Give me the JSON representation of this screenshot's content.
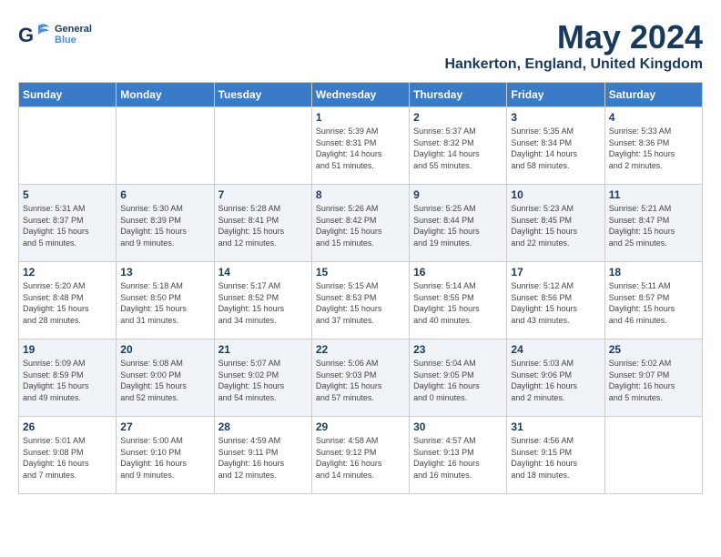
{
  "header": {
    "logo_general": "General",
    "logo_blue": "Blue",
    "month_title": "May 2024",
    "location": "Hankerton, England, United Kingdom"
  },
  "days_of_week": [
    "Sunday",
    "Monday",
    "Tuesday",
    "Wednesday",
    "Thursday",
    "Friday",
    "Saturday"
  ],
  "weeks": [
    [
      {
        "day": "",
        "content": ""
      },
      {
        "day": "",
        "content": ""
      },
      {
        "day": "",
        "content": ""
      },
      {
        "day": "1",
        "content": "Sunrise: 5:39 AM\nSunset: 8:31 PM\nDaylight: 14 hours\nand 51 minutes."
      },
      {
        "day": "2",
        "content": "Sunrise: 5:37 AM\nSunset: 8:32 PM\nDaylight: 14 hours\nand 55 minutes."
      },
      {
        "day": "3",
        "content": "Sunrise: 5:35 AM\nSunset: 8:34 PM\nDaylight: 14 hours\nand 58 minutes."
      },
      {
        "day": "4",
        "content": "Sunrise: 5:33 AM\nSunset: 8:36 PM\nDaylight: 15 hours\nand 2 minutes."
      }
    ],
    [
      {
        "day": "5",
        "content": "Sunrise: 5:31 AM\nSunset: 8:37 PM\nDaylight: 15 hours\nand 5 minutes."
      },
      {
        "day": "6",
        "content": "Sunrise: 5:30 AM\nSunset: 8:39 PM\nDaylight: 15 hours\nand 9 minutes."
      },
      {
        "day": "7",
        "content": "Sunrise: 5:28 AM\nSunset: 8:41 PM\nDaylight: 15 hours\nand 12 minutes."
      },
      {
        "day": "8",
        "content": "Sunrise: 5:26 AM\nSunset: 8:42 PM\nDaylight: 15 hours\nand 15 minutes."
      },
      {
        "day": "9",
        "content": "Sunrise: 5:25 AM\nSunset: 8:44 PM\nDaylight: 15 hours\nand 19 minutes."
      },
      {
        "day": "10",
        "content": "Sunrise: 5:23 AM\nSunset: 8:45 PM\nDaylight: 15 hours\nand 22 minutes."
      },
      {
        "day": "11",
        "content": "Sunrise: 5:21 AM\nSunset: 8:47 PM\nDaylight: 15 hours\nand 25 minutes."
      }
    ],
    [
      {
        "day": "12",
        "content": "Sunrise: 5:20 AM\nSunset: 8:48 PM\nDaylight: 15 hours\nand 28 minutes."
      },
      {
        "day": "13",
        "content": "Sunrise: 5:18 AM\nSunset: 8:50 PM\nDaylight: 15 hours\nand 31 minutes."
      },
      {
        "day": "14",
        "content": "Sunrise: 5:17 AM\nSunset: 8:52 PM\nDaylight: 15 hours\nand 34 minutes."
      },
      {
        "day": "15",
        "content": "Sunrise: 5:15 AM\nSunset: 8:53 PM\nDaylight: 15 hours\nand 37 minutes."
      },
      {
        "day": "16",
        "content": "Sunrise: 5:14 AM\nSunset: 8:55 PM\nDaylight: 15 hours\nand 40 minutes."
      },
      {
        "day": "17",
        "content": "Sunrise: 5:12 AM\nSunset: 8:56 PM\nDaylight: 15 hours\nand 43 minutes."
      },
      {
        "day": "18",
        "content": "Sunrise: 5:11 AM\nSunset: 8:57 PM\nDaylight: 15 hours\nand 46 minutes."
      }
    ],
    [
      {
        "day": "19",
        "content": "Sunrise: 5:09 AM\nSunset: 8:59 PM\nDaylight: 15 hours\nand 49 minutes."
      },
      {
        "day": "20",
        "content": "Sunrise: 5:08 AM\nSunset: 9:00 PM\nDaylight: 15 hours\nand 52 minutes."
      },
      {
        "day": "21",
        "content": "Sunrise: 5:07 AM\nSunset: 9:02 PM\nDaylight: 15 hours\nand 54 minutes."
      },
      {
        "day": "22",
        "content": "Sunrise: 5:06 AM\nSunset: 9:03 PM\nDaylight: 15 hours\nand 57 minutes."
      },
      {
        "day": "23",
        "content": "Sunrise: 5:04 AM\nSunset: 9:05 PM\nDaylight: 16 hours\nand 0 minutes."
      },
      {
        "day": "24",
        "content": "Sunrise: 5:03 AM\nSunset: 9:06 PM\nDaylight: 16 hours\nand 2 minutes."
      },
      {
        "day": "25",
        "content": "Sunrise: 5:02 AM\nSunset: 9:07 PM\nDaylight: 16 hours\nand 5 minutes."
      }
    ],
    [
      {
        "day": "26",
        "content": "Sunrise: 5:01 AM\nSunset: 9:08 PM\nDaylight: 16 hours\nand 7 minutes."
      },
      {
        "day": "27",
        "content": "Sunrise: 5:00 AM\nSunset: 9:10 PM\nDaylight: 16 hours\nand 9 minutes."
      },
      {
        "day": "28",
        "content": "Sunrise: 4:59 AM\nSunset: 9:11 PM\nDaylight: 16 hours\nand 12 minutes."
      },
      {
        "day": "29",
        "content": "Sunrise: 4:58 AM\nSunset: 9:12 PM\nDaylight: 16 hours\nand 14 minutes."
      },
      {
        "day": "30",
        "content": "Sunrise: 4:57 AM\nSunset: 9:13 PM\nDaylight: 16 hours\nand 16 minutes."
      },
      {
        "day": "31",
        "content": "Sunrise: 4:56 AM\nSunset: 9:15 PM\nDaylight: 16 hours\nand 18 minutes."
      },
      {
        "day": "",
        "content": ""
      }
    ]
  ]
}
